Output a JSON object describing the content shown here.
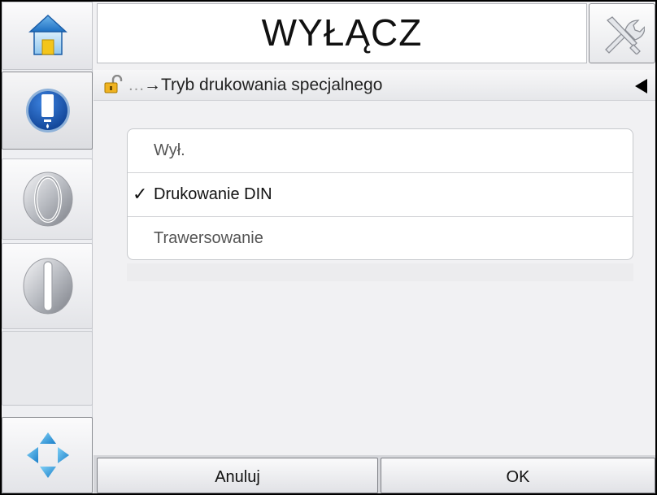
{
  "header": {
    "title": "WYŁĄCZ",
    "home_icon": "home-icon",
    "tools_icon": "tools-icon"
  },
  "sidebar": {
    "buttons": [
      {
        "name": "home-button",
        "icon": "home-icon"
      },
      {
        "name": "ink-status-button",
        "icon": "ink-cartridge-icon"
      },
      {
        "name": "start-button",
        "icon": "start-icon"
      },
      {
        "name": "stop-button",
        "icon": "stop-icon"
      },
      {
        "name": "empty-slot"
      },
      {
        "name": "navigation-button",
        "icon": "navigation-arrows-icon"
      }
    ]
  },
  "breadcrumb": {
    "lock_icon": "unlocked-padlock-icon",
    "ellipsis": "…",
    "arrow": "→",
    "current": "Tryb drukowania specjalnego"
  },
  "options": [
    {
      "label": "Wył.",
      "selected": false
    },
    {
      "label": "Drukowanie DIN",
      "selected": true
    },
    {
      "label": "Trawersowanie",
      "selected": false
    }
  ],
  "check_mark": "✓",
  "footer": {
    "cancel_label": "Anuluj",
    "ok_label": "OK"
  },
  "colors": {
    "accent_blue": "#1f5fbf",
    "check": "#111111"
  }
}
